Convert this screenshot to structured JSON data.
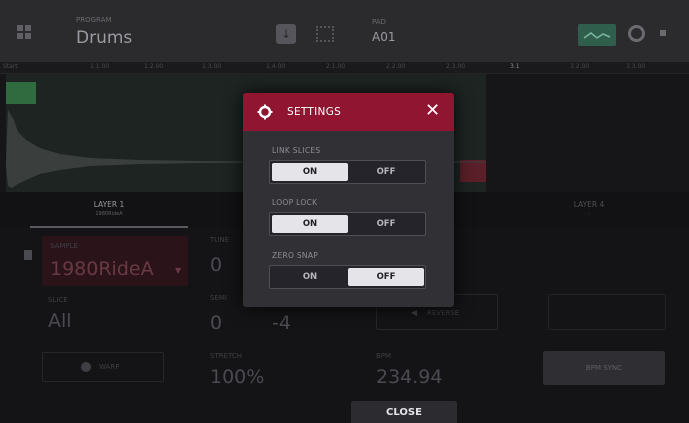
{
  "header": {
    "program_label": "PROGRAM",
    "program_name": "Drums",
    "pad_label": "PAD",
    "pad_value": "A01"
  },
  "ruler": [
    "Start",
    "1.1.00",
    "1.2.00",
    "1.3.00",
    "1.4.00",
    "2.1.00",
    "2.2.00",
    "2.3.00",
    "3.1",
    "3.2.00",
    "3.3.00"
  ],
  "layers": [
    {
      "title": "LAYER 1",
      "sub": "1980RideA"
    },
    {
      "title": "LAYER 4",
      "sub": "-"
    }
  ],
  "params": {
    "sample_label": "SAMPLE",
    "sample_value": "1980RideA",
    "slice_label": "SLICE",
    "slice_value": "All",
    "tune_label": "TUNE",
    "tune_value": "0",
    "semi_label": "SEMI",
    "semi_value": "0",
    "fine_value": "-4",
    "stretch_label": "STRETCH",
    "stretch_value": "100%",
    "bpm_label": "BPM",
    "bpm_value": "234.94",
    "bpm_sync_label": "BPM SYNC",
    "warp_label": "WARP",
    "reverse_label": "REVERSE"
  },
  "dialog": {
    "title": "SETTINGS",
    "settings": [
      {
        "label": "LINK SLICES",
        "on": "ON",
        "off": "OFF",
        "selected": "on"
      },
      {
        "label": "LOOP LOCK",
        "on": "ON",
        "off": "OFF",
        "selected": "on"
      },
      {
        "label": "ZERO SNAP",
        "on": "ON",
        "off": "OFF",
        "selected": "off"
      }
    ]
  },
  "close_label": "CLOSE",
  "colors": {
    "dialog_header": "#8f1530",
    "selected_option": "#e4e4e9",
    "background": "#121214"
  }
}
